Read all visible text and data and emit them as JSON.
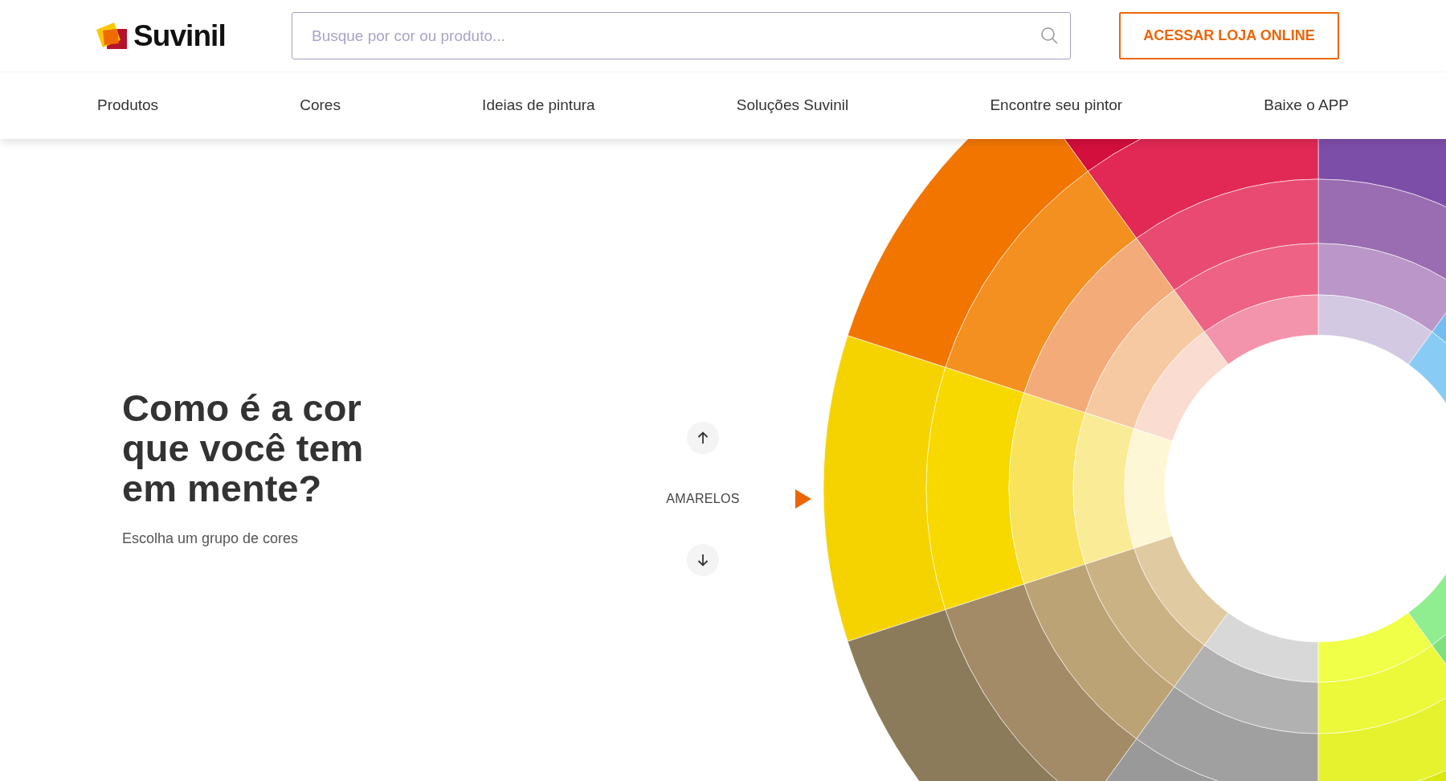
{
  "header": {
    "logo_text": "Suvinil",
    "search": {
      "placeholder": "Busque por cor ou produto..."
    },
    "store_button": "ACESSAR LOJA ONLINE"
  },
  "nav": {
    "items": [
      {
        "label": "Produtos"
      },
      {
        "label": "Cores"
      },
      {
        "label": "Ideias de pintura"
      },
      {
        "label": "Soluções Suvinil"
      },
      {
        "label": "Encontre seu pintor"
      },
      {
        "label": "Baixe o APP"
      }
    ]
  },
  "hero": {
    "title": "Como é a cor que você tem em mente?",
    "subtitle": "Escolha um grupo de cores"
  },
  "color_selector": {
    "group_label": "AMARELOS"
  }
}
